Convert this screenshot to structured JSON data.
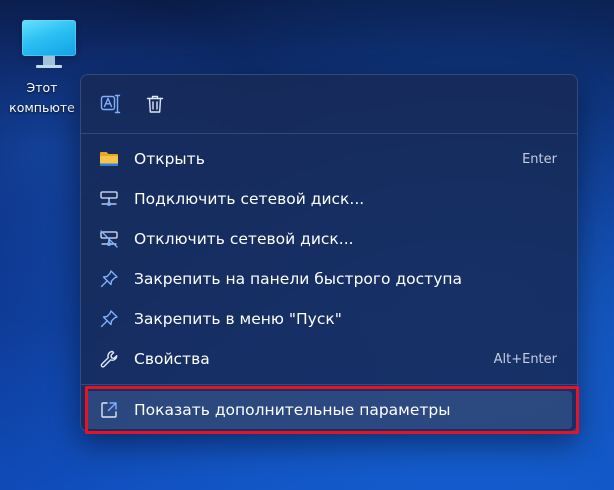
{
  "desktop": {
    "icon_label_line1": "Этот",
    "icon_label_line2": "компьюте"
  },
  "top_actions": [
    {
      "icon": "rename-icon"
    },
    {
      "icon": "delete-icon"
    }
  ],
  "menu": {
    "items": [
      {
        "label": "Открыть",
        "shortcut": "Enter",
        "icon": "folder-icon"
      },
      {
        "label": "Подключить сетевой диск...",
        "shortcut": "",
        "icon": "map-network-drive-icon"
      },
      {
        "label": "Отключить сетевой диск...",
        "shortcut": "",
        "icon": "disconnect-network-drive-icon"
      },
      {
        "label": "Закрепить на панели быстрого доступа",
        "shortcut": "",
        "icon": "pin-icon"
      },
      {
        "label": "Закрепить в меню \"Пуск\"",
        "shortcut": "",
        "icon": "pin-icon"
      },
      {
        "label": "Свойства",
        "shortcut": "Alt+Enter",
        "icon": "wrench-icon"
      }
    ],
    "more_options": {
      "label": "Показать дополнительные параметры",
      "icon": "show-more-options-icon"
    }
  },
  "colors": {
    "annotation": "#ea1122",
    "icon_accent": "#7fb0ff",
    "folder": "#f6c44a"
  }
}
